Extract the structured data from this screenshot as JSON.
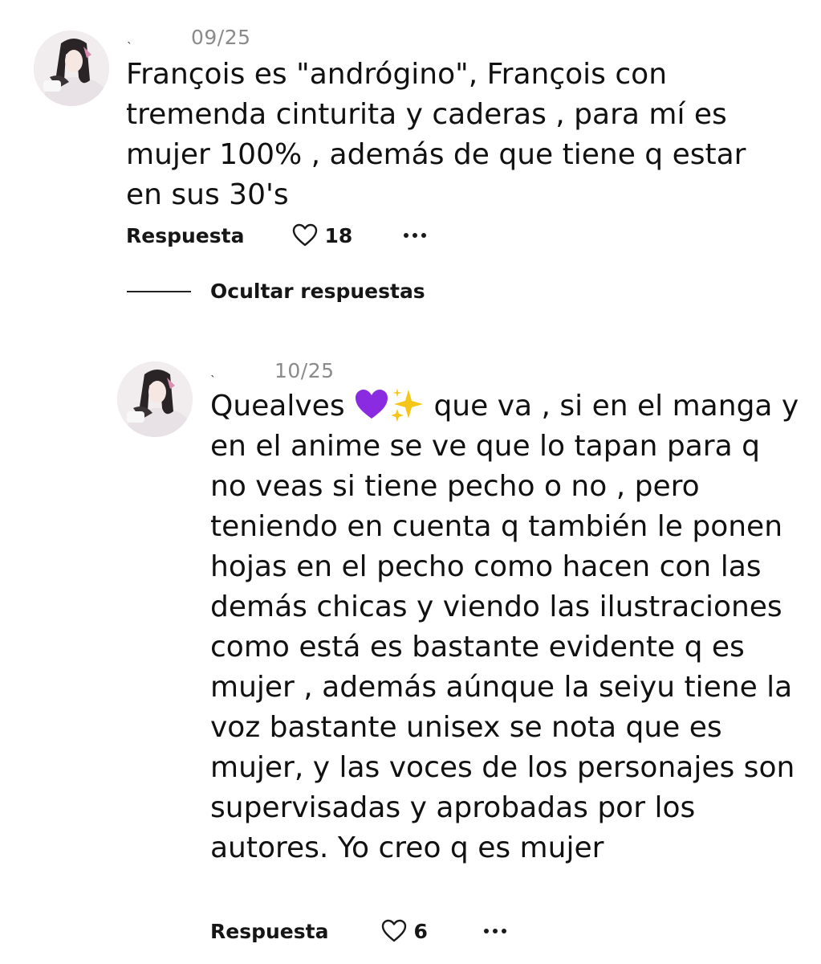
{
  "comments": [
    {
      "username": "ˎ",
      "date": "09/25",
      "text": "François es \"andrógino\", François con tremenda cinturita y caderas , para mí es mujer 100% , además de que tiene q estar en sus 30's",
      "reply_label": "Respuesta",
      "likes": "18"
    },
    {
      "username": "ˎ",
      "date": "10/25",
      "text_before_emoji": "Quealves ",
      "text_after_emoji": " que va , si en el manga y en el anime se ve que lo tapan para q no veas si tiene pecho o no , pero teniendo en cuenta q también le ponen hojas en el pecho como hacen con las demás chicas y viendo las ilustraciones como está es bastante evidente q es mujer , además aúnque la seiyu tiene la voz bastante unisex se nota que es mujer, y las voces de los personajes son supervisadas y aprobadas por los autores. Yo creo q es mujer",
      "reply_label": "Respuesta",
      "likes": "6"
    }
  ],
  "hide_replies_label": "Ocultar respuestas",
  "icons": {
    "like": "heart-outline-icon",
    "more": "more-dots-icon",
    "emoji1": "purple-heart-emoji",
    "emoji2": "sparkles-emoji"
  },
  "colors": {
    "date": "#8a8a8a",
    "text": "#111111",
    "purple_heart": "#8a2be2",
    "sparkle": "#f5c518"
  }
}
